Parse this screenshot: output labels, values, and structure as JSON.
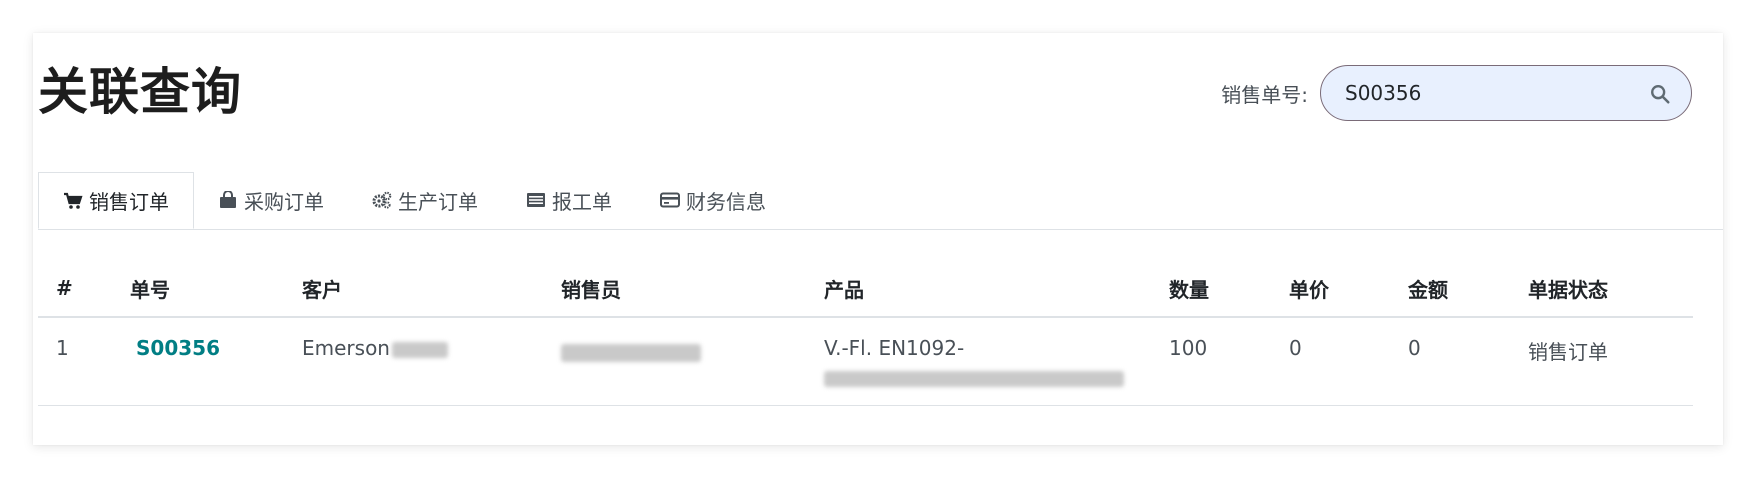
{
  "page": {
    "title": "关联查询"
  },
  "search": {
    "label": "销售单号:",
    "value": "S00356",
    "icon": "search-icon"
  },
  "tabs": [
    {
      "label": "销售订单",
      "icon": "cart-icon",
      "active": true
    },
    {
      "label": "采购订单",
      "icon": "shopping-bag-icon",
      "active": false
    },
    {
      "label": "生产订单",
      "icon": "gears-icon",
      "active": false
    },
    {
      "label": "报工单",
      "icon": "list-icon",
      "active": false
    },
    {
      "label": "财务信息",
      "icon": "credit-card-icon",
      "active": false
    }
  ],
  "table": {
    "headers": [
      "#",
      "单号",
      "客户",
      "销售员",
      "产品",
      "数量",
      "单价",
      "金额",
      "单据状态"
    ],
    "rows": [
      {
        "index": "1",
        "order_no": "S00356",
        "customer": "Emerson",
        "salesperson": "",
        "product": "V.-Fl. EN1092-",
        "quantity": "100",
        "unit_price": "0",
        "amount": "0",
        "status": "销售订单"
      }
    ]
  },
  "colors": {
    "accent": "#017e84",
    "search_bg": "#e8f0fe"
  }
}
